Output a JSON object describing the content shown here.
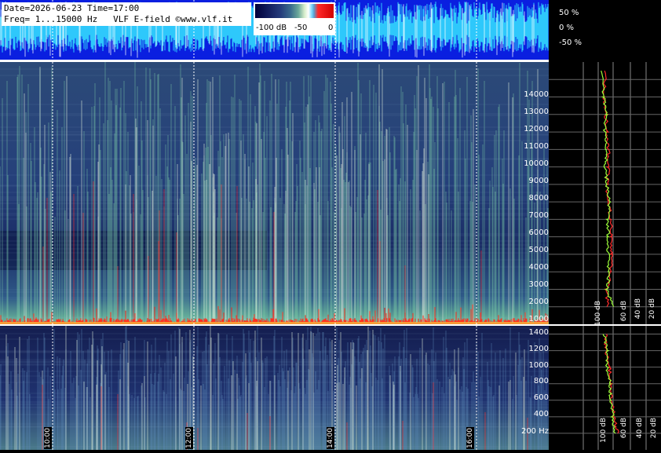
{
  "header": {
    "line1": "Date=2026-06-23 Time=17:00",
    "line2": "Freq= 1...15000 Hz   VLF E-field ©www.vlf.it"
  },
  "colorbar": {
    "ticks": [
      "-100 dB",
      "-50",
      "0"
    ]
  },
  "waveform": {
    "percent_labels": [
      "50 %",
      "0 %",
      "-50 %"
    ]
  },
  "time_labels": [
    "10:00",
    "12:00",
    "14:00",
    "16:00"
  ],
  "colors": {
    "wave_bg": "#0a1fe0",
    "wave_trace": "#35e6ff",
    "strong": "#ff2a2a",
    "avg_green": "#9cff3a"
  },
  "chart_data": [
    {
      "type": "heatmap",
      "title": "",
      "panel": "upper spectrogram",
      "ylabel": "Hz",
      "y_ticks": [
        1000,
        2000,
        3000,
        4000,
        5000,
        6000,
        7000,
        8000,
        9000,
        10000,
        11000,
        12000,
        13000,
        14000
      ],
      "ylim": [
        0,
        15000
      ],
      "x_ticks": [
        "10:00",
        "12:00",
        "14:00",
        "16:00"
      ]
    },
    {
      "type": "heatmap",
      "panel": "lower spectrogram",
      "y_ticks": [
        "200 Hz",
        "400",
        "600",
        "800",
        "1000",
        "1200",
        "1400"
      ],
      "ylim": [
        0,
        1500
      ],
      "x_ticks": [
        "10:00",
        "12:00",
        "14:00",
        "16:00"
      ]
    },
    {
      "type": "line",
      "panel": "upper spectrum profile",
      "x_ticks": [
        "100 dB",
        "60 dB",
        "40 dB",
        "20 dB"
      ],
      "series": [
        {
          "x": [
            -85,
            -84,
            -80,
            -79,
            -80,
            -81,
            -82,
            -83,
            -84,
            -85,
            -86,
            -88,
            -89,
            -88
          ],
          "y": [
            1000,
            2000,
            3000,
            4000,
            5000,
            6000,
            7000,
            8000,
            9000,
            10000,
            11000,
            12000,
            13000,
            14500
          ]
        },
        {
          "x": [
            -78,
            -86,
            -84,
            -82,
            -82,
            -83,
            -83,
            -84,
            -85,
            -86,
            -87,
            -88,
            -89,
            -90
          ],
          "y": [
            1000,
            2000,
            3000,
            4000,
            5000,
            6000,
            7000,
            8000,
            9000,
            10000,
            11000,
            12000,
            13000,
            14500
          ]
        }
      ]
    },
    {
      "type": "line",
      "panel": "lower spectrum profile",
      "x_ticks": [
        "100 dB",
        "60 dB",
        "40 dB",
        "20 dB"
      ],
      "series": [
        {
          "x": [
            -70,
            -74,
            -78,
            -80,
            -83,
            -86,
            -88
          ],
          "y": [
            200,
            400,
            600,
            800,
            1000,
            1200,
            1400
          ]
        },
        {
          "x": [
            -72,
            -76,
            -80,
            -82,
            -84,
            -87,
            -89
          ],
          "y": [
            200,
            400,
            600,
            800,
            1000,
            1200,
            1400
          ]
        }
      ]
    }
  ]
}
